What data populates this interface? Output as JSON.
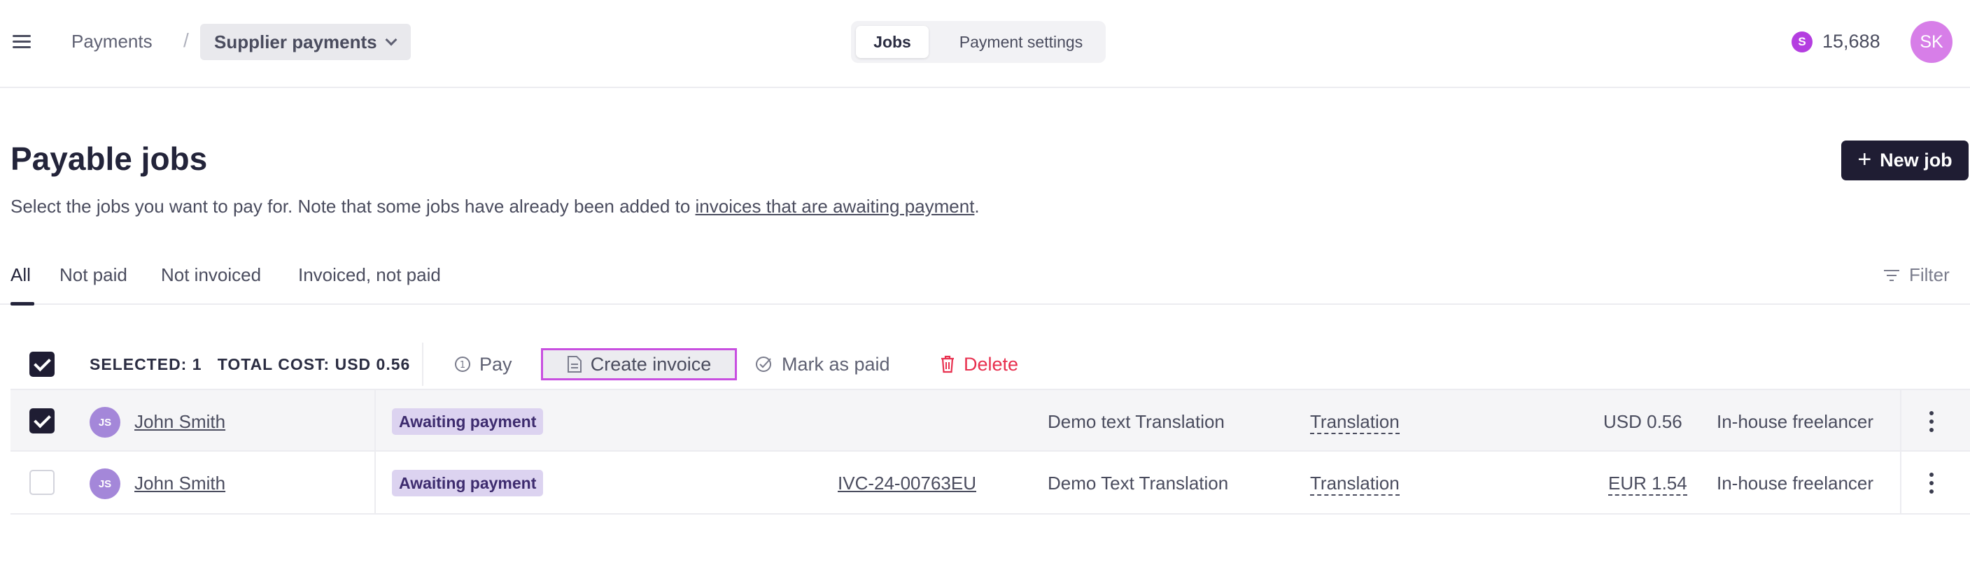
{
  "header": {
    "breadcrumb_root": "Payments",
    "breadcrumb_separator": "/",
    "breadcrumb_current": "Supplier payments",
    "tabs": [
      {
        "label": "Jobs",
        "active": true
      },
      {
        "label": "Payment settings",
        "active": false
      }
    ],
    "credits_symbol": "S",
    "credits_value": "15,688",
    "avatar_initials": "SK"
  },
  "page": {
    "title": "Payable jobs",
    "subtitle_prefix": "Select the jobs you want to pay for. Note that some jobs have already been added to ",
    "subtitle_link": "invoices that are awaiting payment",
    "subtitle_suffix": ".",
    "new_job_label": "New job"
  },
  "filter_tabs": {
    "items": [
      "All",
      "Not paid",
      "Not invoiced",
      "Invoiced, not paid"
    ],
    "active": "All",
    "filter_label": "Filter"
  },
  "action_bar": {
    "selected_text": "SELECTED: 1",
    "total_text": "TOTAL COST: USD 0.56",
    "pay_label": "Pay",
    "create_invoice_label": "Create invoice",
    "mark_paid_label": "Mark as paid",
    "delete_label": "Delete"
  },
  "rows": [
    {
      "checked": true,
      "initials": "JS",
      "name": "John Smith",
      "status": "Awaiting payment",
      "invoice": "",
      "job_name": "Demo text Translation",
      "job_type": "Translation",
      "amount": "USD 0.56",
      "provider": "In-house freelancer"
    },
    {
      "checked": false,
      "initials": "JS",
      "name": "John Smith",
      "status": "Awaiting payment",
      "invoice": "IVC-24-00763EU",
      "job_name": "Demo Text Translation",
      "job_type": "Translation",
      "amount": "EUR 1.54",
      "provider": "In-house freelancer"
    }
  ],
  "colors": {
    "primary_dark": "#1f1d33",
    "accent_purple": "#c84fe0",
    "delete_red": "#e8304f",
    "badge_bg": "#dcd3f0"
  }
}
